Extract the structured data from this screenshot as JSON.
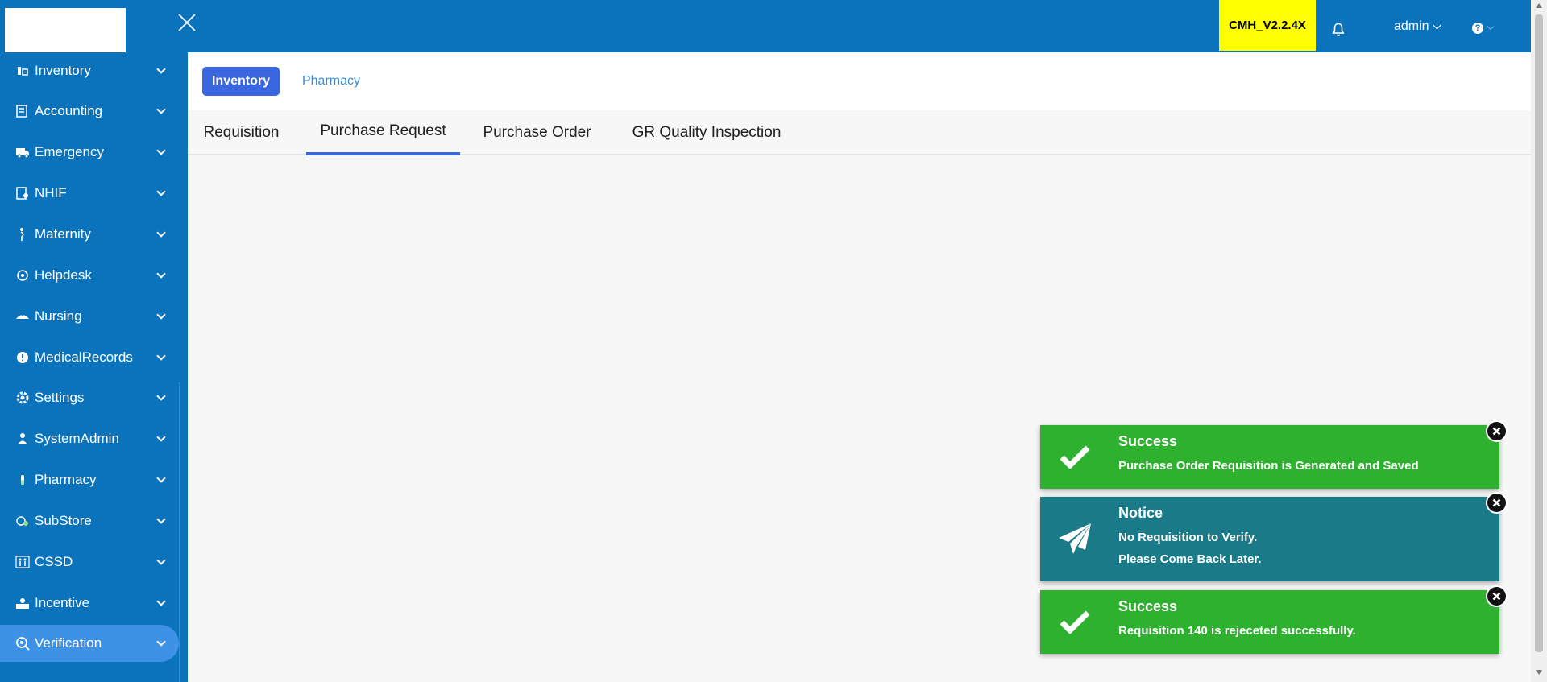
{
  "header": {
    "version_label": "CMH_V2.2.4X",
    "user_label": "admin",
    "help_glyph": "?"
  },
  "sidebar": {
    "items": [
      {
        "label": "Inventory",
        "icon": "inventory-icon"
      },
      {
        "label": "Accounting",
        "icon": "accounting-icon"
      },
      {
        "label": "Emergency",
        "icon": "ambulance-icon"
      },
      {
        "label": "NHIF",
        "icon": "nhif-icon"
      },
      {
        "label": "Maternity",
        "icon": "maternity-icon"
      },
      {
        "label": "Helpdesk",
        "icon": "helpdesk-icon"
      },
      {
        "label": "Nursing",
        "icon": "nursing-icon"
      },
      {
        "label": "MedicalRecords",
        "icon": "medical-records-icon"
      },
      {
        "label": "Settings",
        "icon": "settings-icon"
      },
      {
        "label": "SystemAdmin",
        "icon": "system-admin-icon"
      },
      {
        "label": "Pharmacy",
        "icon": "pharmacy-icon"
      },
      {
        "label": "SubStore",
        "icon": "substore-icon"
      },
      {
        "label": "CSSD",
        "icon": "cssd-icon"
      },
      {
        "label": "Incentive",
        "icon": "incentive-icon"
      },
      {
        "label": "Verification",
        "icon": "verification-icon",
        "active": true
      }
    ]
  },
  "module_tabs": [
    {
      "label": "Inventory",
      "active": true
    },
    {
      "label": "Pharmacy",
      "active": false
    }
  ],
  "sub_tabs": [
    {
      "label": "Requisition",
      "active": false
    },
    {
      "label": "Purchase Request",
      "active": true
    },
    {
      "label": "Purchase Order",
      "active": false
    },
    {
      "label": "GR Quality Inspection",
      "active": false
    }
  ],
  "toasts": [
    {
      "type": "success",
      "title": "Success",
      "lines": [
        "Purchase Order Requisition is Generated and Saved"
      ],
      "color": "#2eb12e"
    },
    {
      "type": "notice",
      "title": "Notice",
      "lines": [
        "No Requisition to Verify.",
        "Please Come Back Later."
      ],
      "color": "#1a7a87"
    },
    {
      "type": "success",
      "title": "Success",
      "lines": [
        "Requisition 140 is rejeceted successfully."
      ],
      "color": "#2eb12e"
    }
  ],
  "colors": {
    "primary": "#0a73bc",
    "accent": "#3a67e0",
    "version_badge": "#ffff00",
    "success": "#2eb12e",
    "notice": "#1a7a87"
  }
}
